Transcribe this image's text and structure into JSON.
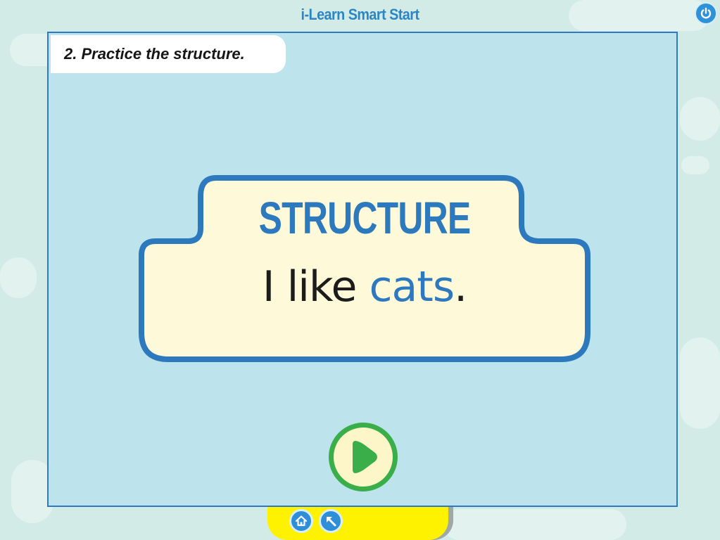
{
  "app": {
    "title": "i-Learn Smart Start"
  },
  "activity": {
    "instruction": "2. Practice the structure.",
    "card_heading": "STRUCTURE",
    "sentence_start": "I like ",
    "sentence_highlight": "cats",
    "sentence_end": "."
  },
  "controls": {
    "power": "power-icon",
    "play": "play-icon",
    "home": "home-icon",
    "back": "back-arrow-icon"
  },
  "colors": {
    "background": "#d3ebe7",
    "board": "#bde4ec",
    "card_fill": "#fef9d9",
    "card_border": "#2d79bd",
    "accent_blue": "#2c79bf",
    "play_green": "#3aae49",
    "tray_yellow": "#fff200"
  }
}
